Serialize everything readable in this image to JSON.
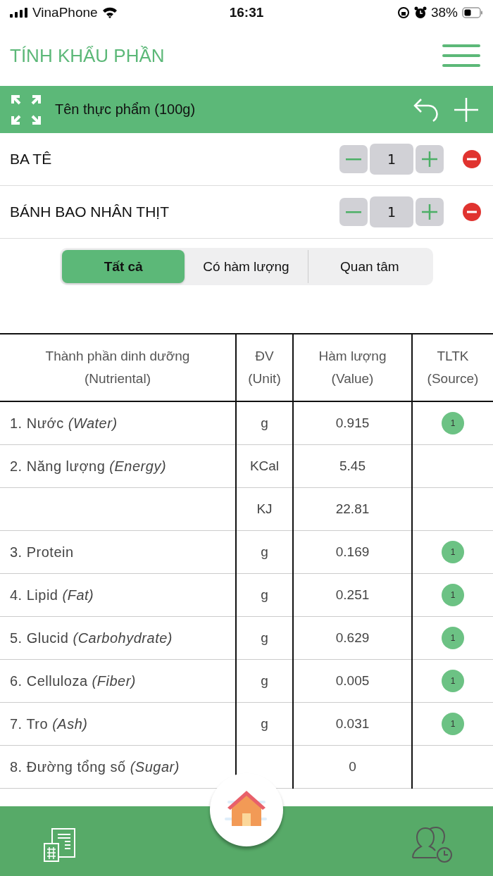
{
  "status_bar": {
    "carrier": "VinaPhone",
    "time": "16:31",
    "battery": "38%"
  },
  "header": {
    "title": "TÍNH KHẨU PHẦN"
  },
  "food_bar": {
    "title": "Tên thực phẩm (100g)"
  },
  "foods": [
    {
      "name": "BA TÊ",
      "quantity": "1"
    },
    {
      "name": "BÁNH BAO NHÂN THỊT",
      "quantity": "1"
    }
  ],
  "filter_tabs": [
    {
      "label": "Tất cả",
      "selected": true
    },
    {
      "label": "Có hàm lượng",
      "selected": false
    },
    {
      "label": "Quan tâm",
      "selected": false
    }
  ],
  "table": {
    "columns": [
      "Thành phần dinh dưỡng\n(Nutriental)",
      "ĐV\n(Unit)",
      "Hàm lượng\n(Value)",
      "TLTK\n(Source)"
    ],
    "rows": [
      {
        "name": "1. Nước *(Water)*",
        "unit": "g",
        "value": "0.915",
        "source": "1"
      },
      {
        "name": "2. Năng lượng *(Energy)*",
        "unit": "KCal",
        "value": "5.45"
      },
      {
        "unit": "KJ",
        "value": "22.81"
      },
      {
        "name": "3. Protein",
        "unit": "g",
        "value": "0.169",
        "source": "1"
      },
      {
        "name": "4. Lipid *(Fat)*",
        "unit": "g",
        "value": "0.251",
        "source": "1"
      },
      {
        "name": "5. Glucid *(Carbohydrate)*",
        "unit": "g",
        "value": "0.629",
        "source": "1"
      },
      {
        "name": "6. Celluloza *(Fiber)*",
        "unit": "g",
        "value": "0.005",
        "source": "1"
      },
      {
        "name": "7. Tro *(Ash)*",
        "unit": "g",
        "value": "0.031",
        "source": "1"
      },
      {
        "name": "8. Đường tổng số *(Sugar)*",
        "value": "0"
      }
    ]
  }
}
